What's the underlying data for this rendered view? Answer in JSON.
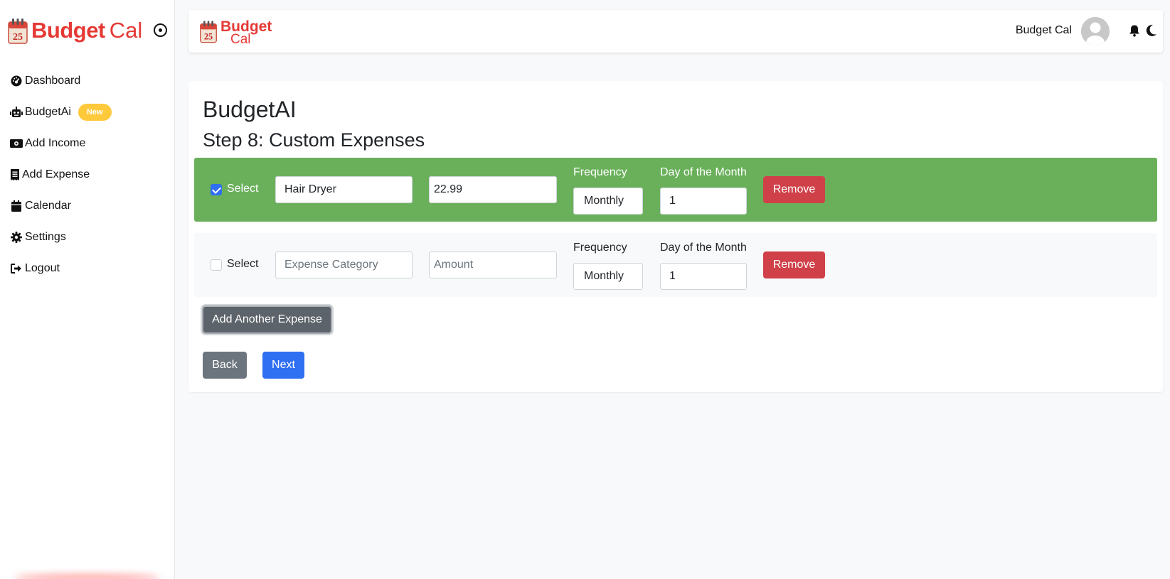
{
  "sidebar": {
    "brand_bold": "Budget",
    "brand_light": "Cal",
    "calendar_day": "25",
    "items": [
      {
        "label": "Dashboard",
        "icon": "dashboard-icon"
      },
      {
        "label": "BudgetAi",
        "icon": "robot-icon",
        "badge": "New"
      },
      {
        "label": "Add Income",
        "icon": "money-icon"
      },
      {
        "label": "Add Expense",
        "icon": "receipt-icon"
      },
      {
        "label": "Calendar",
        "icon": "calendar-icon"
      },
      {
        "label": "Settings",
        "icon": "gear-icon"
      },
      {
        "label": "Logout",
        "icon": "logout-icon"
      }
    ]
  },
  "topbar": {
    "logo_line1": "Budget",
    "logo_line2": "Cal",
    "calendar_day": "25",
    "username": "Budget Cal"
  },
  "main": {
    "title": "BudgetAI",
    "step": "Step 8: Custom Expenses",
    "expenses": [
      {
        "selected": true,
        "select_label": "Select",
        "category_value": "Hair Dryer",
        "category_placeholder": "Expense Category",
        "amount_value": "22.99",
        "amount_placeholder": "Amount",
        "frequency_label": "Frequency",
        "frequency_value": "Monthly",
        "day_label": "Day of the Month",
        "day_value": "1",
        "remove_label": "Remove"
      },
      {
        "selected": false,
        "select_label": "Select",
        "category_value": "",
        "category_placeholder": "Expense Category",
        "amount_value": "",
        "amount_placeholder": "Amount",
        "frequency_label": "Frequency",
        "frequency_value": "Monthly",
        "day_label": "Day of the Month",
        "day_value": "1",
        "remove_label": "Remove"
      }
    ],
    "add_button": "Add Another Expense",
    "back_button": "Back",
    "next_button": "Next"
  },
  "colors": {
    "brand_red": "#e53935",
    "selected_row": "#6ab05b",
    "primary": "#2f6ff2",
    "danger": "#d04048",
    "secondary": "#6c757d",
    "badge": "#ffc93c"
  }
}
